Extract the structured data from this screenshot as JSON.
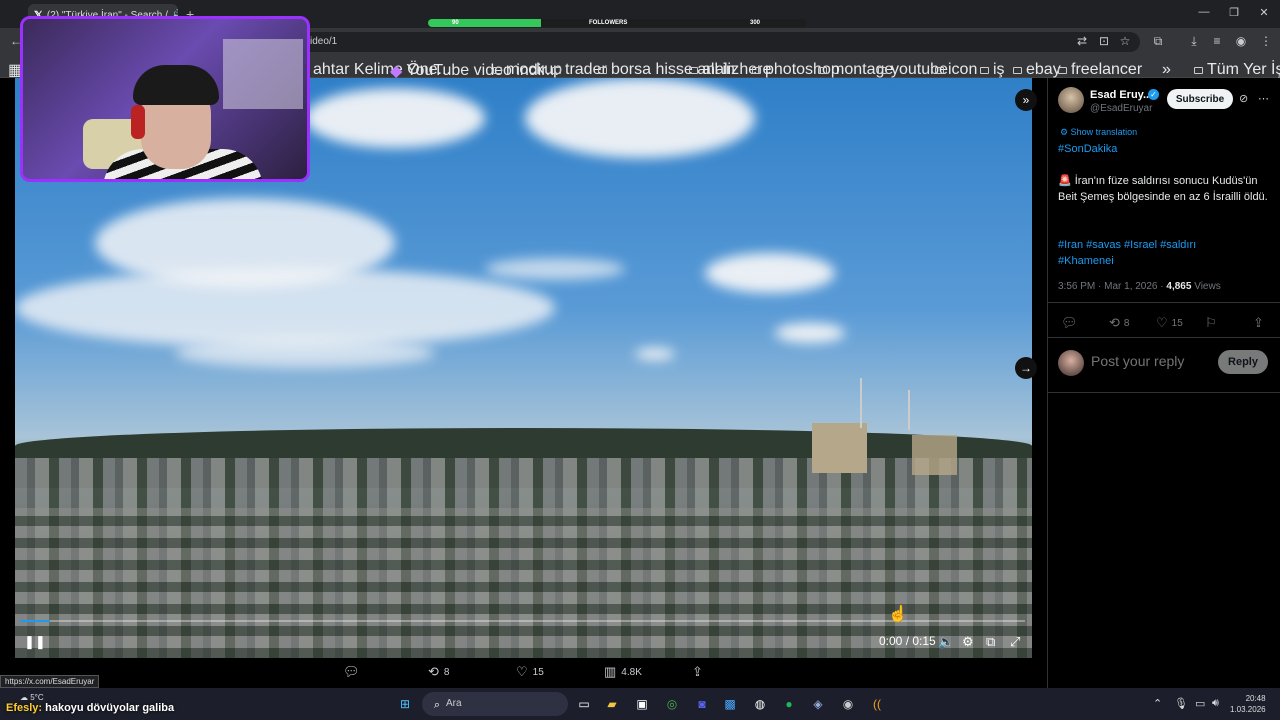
{
  "browser": {
    "tab_title": "(2) \"Türkiye İran\" - Search /",
    "url_fragment": "ideo/1",
    "bookmarks": [
      "ahtar Kelime Öne...",
      "YouTube video indir...",
      "mockup",
      "trader",
      "borsa hisse analiz",
      "all in here",
      "photoshop",
      "montage",
      "youtube",
      "icon",
      "iş",
      "ebay",
      "freelancer"
    ],
    "bookmarks_right": "Tüm Yer İşaretleri",
    "status_url": "https://x.com/EsadEruyar"
  },
  "stream_overlay": {
    "left_count": "90",
    "label": "FOLLOWERS",
    "right_count": "300",
    "progress_fraction": 0.3
  },
  "video": {
    "timecode": "0:00 / 0:15",
    "progress_fraction": 0.03,
    "actions": {
      "reposts": "8",
      "likes": "15",
      "views": "4.8K"
    }
  },
  "tweet": {
    "author_name": "Esad Eruy...",
    "handle": "@EsadEruyar",
    "subscribe_label": "Subscribe",
    "show_translation": "Show translation",
    "hashtag_top": "#SonDakika",
    "body": "🚨 İran'ın füze saldırısı sonucu Kudüs'ün Beit Şemeş bölgesinde en az 6 İsrailli öldü.",
    "hashtags_line1": "#Iran #savas #Israel #saldırı",
    "hashtags_line2": "#Khamenei",
    "timestamp": "3:56 PM · Mar 1, 2026 · ",
    "views_count": "4,865",
    "views_label": " Views",
    "reposts": "8",
    "likes": "15"
  },
  "reply": {
    "placeholder": "Post your reply",
    "button_label": "Reply"
  },
  "taskbar": {
    "weather": "5°C",
    "search_placeholder": "Ara",
    "time": "20:48",
    "date": "1.03.2026"
  },
  "chat": {
    "user": "Efesly:",
    "message": " hakoyu dövüyolar galiba"
  },
  "colors": {
    "accent": "#1d9bf0",
    "webcam_border": "#9b30ff",
    "stream_bar": "#34c759"
  }
}
